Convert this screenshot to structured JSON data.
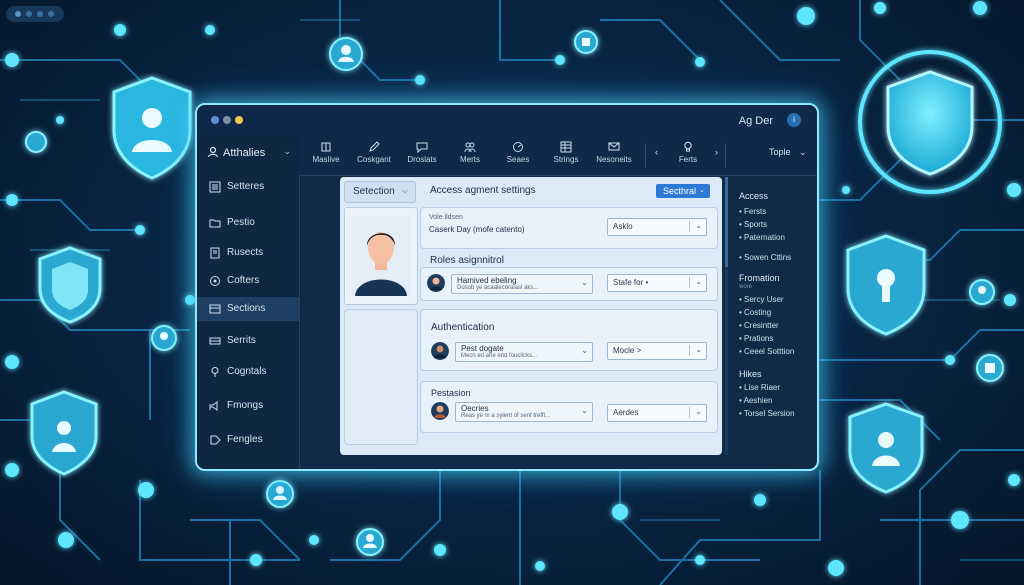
{
  "colors": {
    "accent": "#2d7ad6",
    "glow": "#5ee6ff",
    "window_bg": "#102a47",
    "panel_bg": "#dce9f6"
  },
  "window": {
    "user_name": "Ag Der",
    "user_avatar_letter": "i"
  },
  "sidebar": {
    "header": {
      "label": "Atthalies",
      "icon": "users-icon"
    },
    "items": [
      {
        "label": "Setteres",
        "icon": "list-icon"
      },
      {
        "label": "Pestio",
        "icon": "folder-icon"
      },
      {
        "label": "Rusects",
        "icon": "document-icon"
      },
      {
        "label": "Cofters",
        "icon": "settings-icon"
      },
      {
        "label": "Sections",
        "icon": "grid-icon"
      },
      {
        "label": "Serrits",
        "icon": "panel-icon"
      },
      {
        "label": "Cogntals",
        "icon": "pin-icon"
      },
      {
        "label": "Fmongs",
        "icon": "share-icon"
      },
      {
        "label": "Fengles",
        "icon": "tag-icon"
      }
    ]
  },
  "toolbar": {
    "tools": [
      {
        "label": "Maslive",
        "icon": "book-icon"
      },
      {
        "label": "Coskgant",
        "icon": "pen-icon"
      },
      {
        "label": "Droslats",
        "icon": "chat-icon"
      },
      {
        "label": "Merts",
        "icon": "people-icon"
      },
      {
        "label": "Seaes",
        "icon": "gauge-icon"
      },
      {
        "label": "Strings",
        "icon": "table-icon"
      },
      {
        "label": "Nesoneits",
        "icon": "message-icon"
      }
    ],
    "ferts_label": "Ferts",
    "ferts_icon": "lightbulb-icon",
    "prev": "‹",
    "next": "›",
    "topple_label": "Tople"
  },
  "main": {
    "selection_label": "Setection",
    "title": "Access agment settings",
    "section_button": "Secthral",
    "profile": {
      "small": "Vole ildsen",
      "name": "Caserk Day (mofe catento)",
      "dropdown": "Asklo"
    },
    "roles": {
      "title": "Roles asignnitrol",
      "row_label": "Hamived ebeling",
      "row_sub": "Dosob ye acaalecoraiasl aks...",
      "row_dropdown": "",
      "right_dropdown": "Stafe for •"
    },
    "auth": {
      "title": "Authentication",
      "row_label": "Pest dogate",
      "row_sub": "Mecn ed arle end fouclicks...",
      "row_dropdown": "",
      "right_dropdown": "Mocle >"
    },
    "permission": {
      "title": "Pestasion",
      "row_label": "Oecries",
      "row_sub": "Reas ye m a syient of senf treffl...",
      "row_dropdown": "",
      "right_dropdown": "Aerdes"
    }
  },
  "right_panel": {
    "access": {
      "title": "Access",
      "items": [
        "• Fersts",
        "• Sports",
        "• Paternation",
        "• Sowen Cttins"
      ]
    },
    "promotion": {
      "title": "Fromation",
      "sub": "wore",
      "items": [
        "• Sercy User",
        "• Costing",
        "• Cresintter",
        "• Prations",
        "• Ceeel Sotttion"
      ]
    },
    "hikes": {
      "title": "Hikes",
      "items": [
        "• Lise Riaer",
        "• Aeshien",
        "• Torsel Sersion"
      ]
    }
  }
}
